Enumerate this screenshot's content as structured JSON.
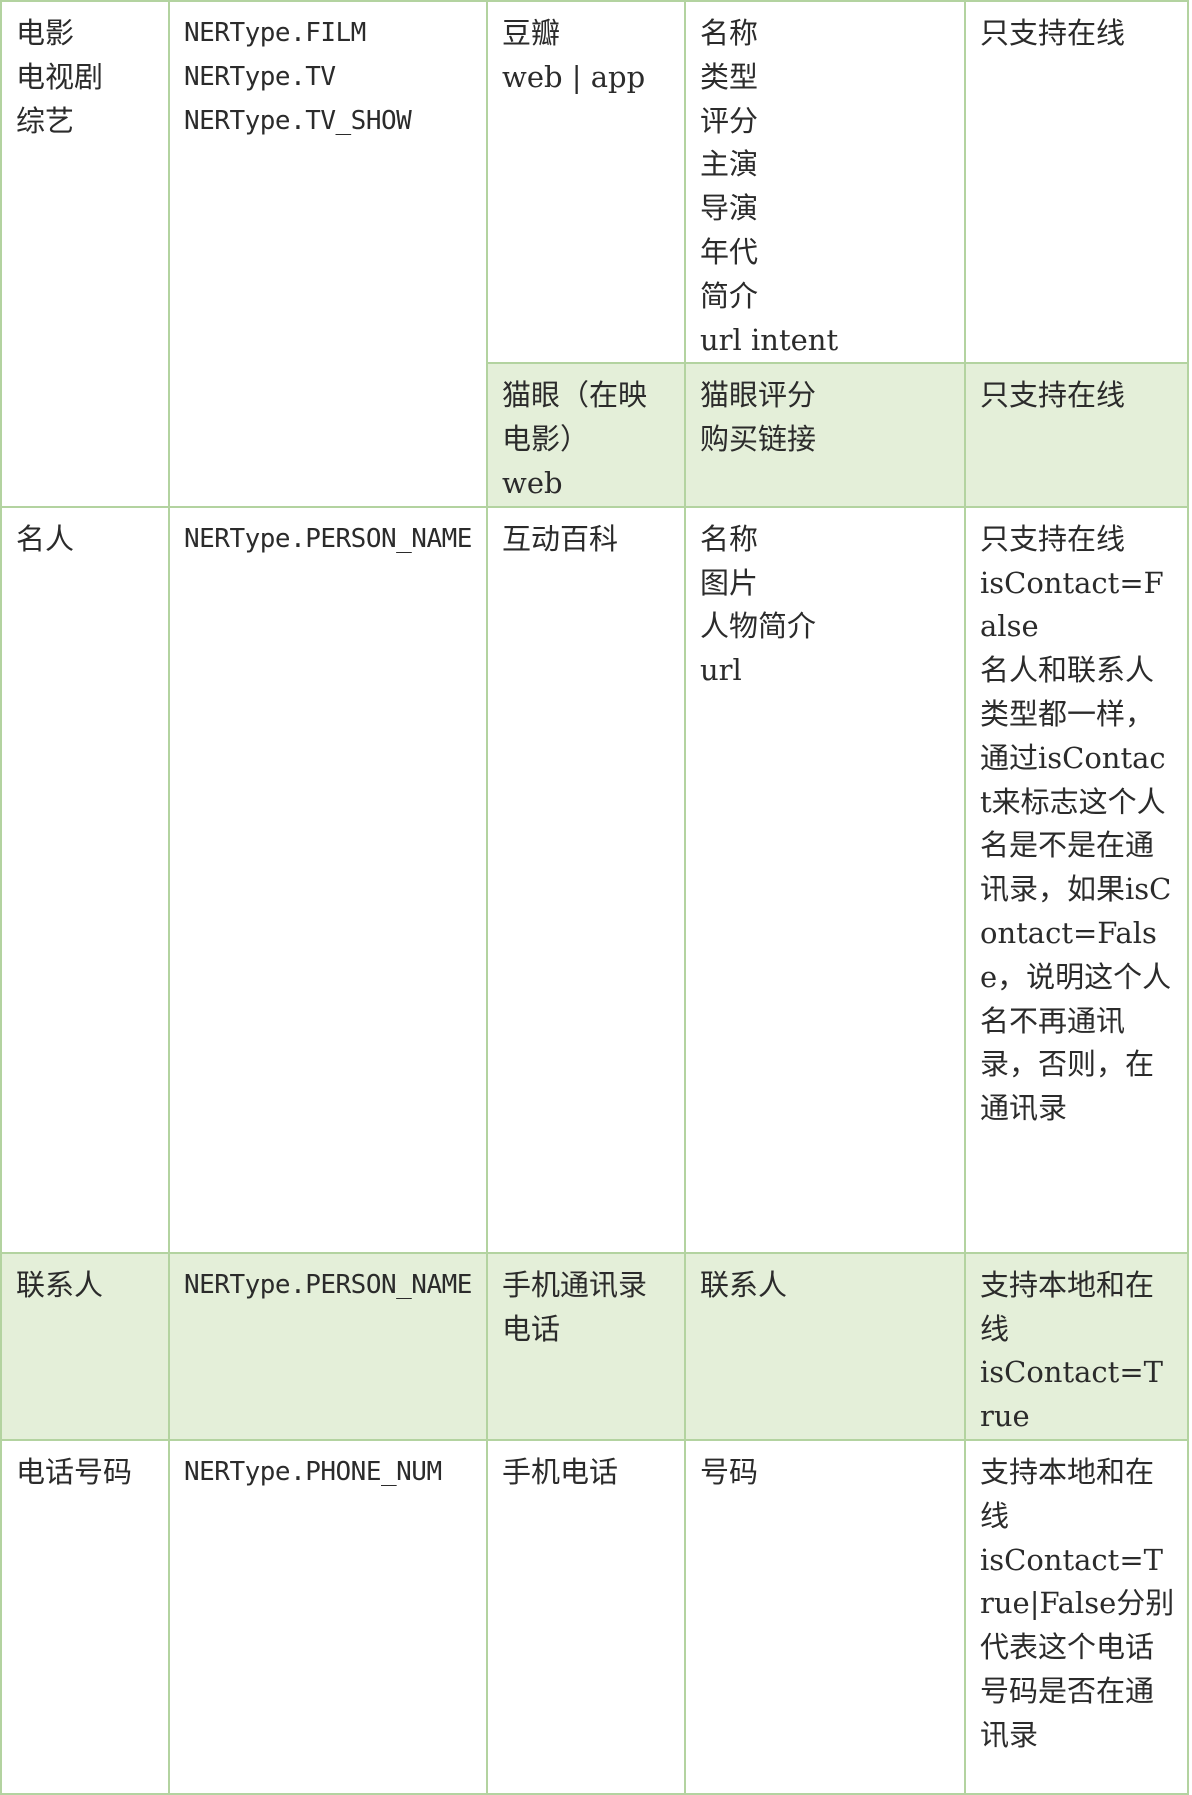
{
  "table": {
    "rows": [
      {
        "category": "电影\n电视剧\n综艺",
        "ner_type": "NERType.FILM\nNERType.TV\nNERType.TV_SHOW",
        "source": "豆瓣\nweb | app",
        "fields": "名称\n类型\n评分\n主演\n导演\n年代\n简介\nurl intent",
        "notes": "只支持在线"
      },
      {
        "source": "猫眼（在映电影）\nweb",
        "fields": "猫眼评分\n购买链接",
        "notes": "只支持在线"
      },
      {
        "category": "名人",
        "ner_type": "NERType.PERSON_NAME",
        "source": "互动百科",
        "fields": "名称\n图片\n人物简介\nurl",
        "notes": "只支持在线\nisContact=False\n名人和联系人类型都一样，通过isContact来标志这个人名是不是在通讯录，如果isContact=False，说明这个人名不再通讯录，否则，在通讯录"
      },
      {
        "category": "联系人",
        "ner_type": "NERType.PERSON_NAME",
        "source": "手机通讯录\n电话",
        "fields": "联系人",
        "notes": "支持本地和在线\nisContact=True"
      },
      {
        "category": "电话号码",
        "ner_type": "NERType.PHONE_NUM",
        "source": "手机电话",
        "fields": "号码",
        "notes": "支持本地和在线\nisContact=True|False分别代表这个电话号码是否在通讯录"
      }
    ]
  },
  "colors": {
    "border": "#b3d3a0",
    "shade": "#e4efd9",
    "text": "#2b2b2b"
  }
}
